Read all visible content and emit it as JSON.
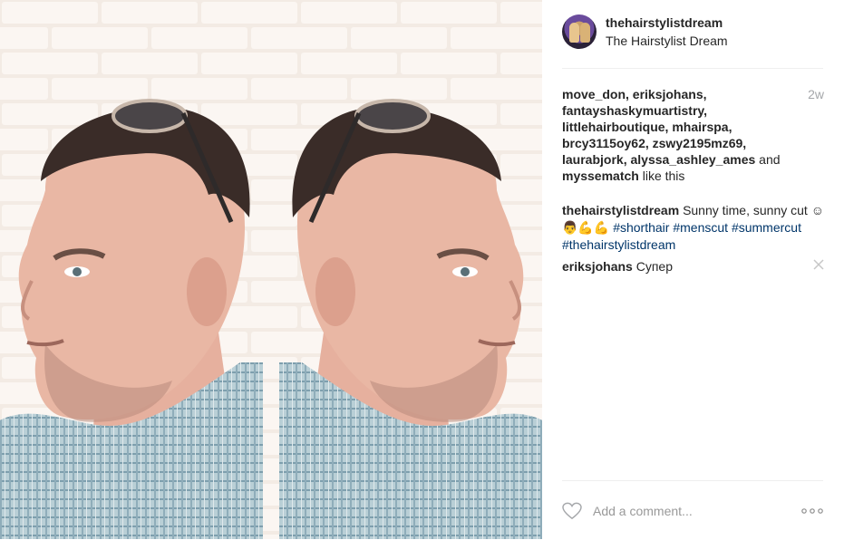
{
  "post": {
    "image_alt": "",
    "author": {
      "username": "thehairstylistdream",
      "full_name": "The Hairstylist Dream"
    },
    "time_ago": "2w",
    "likes": {
      "users": [
        "move_don,",
        "eriksjohans,",
        "fantayshaskymuartistry,",
        "littlehairboutique,",
        "mhairspa,",
        "brcy3115oy62,",
        "zswy2195mz69,",
        "laurabjork,",
        "alyssa_ashley_ames",
        "myssematch"
      ],
      "and_text": "and",
      "suffix": "like this"
    },
    "caption": {
      "username": "thehairstylistdream",
      "text": "Sunny time, sunny cut",
      "emoji": "☺👨💪💪",
      "hashtags": [
        "#shorthair",
        "#menscut",
        "#summercut",
        "#thehairstylistdream"
      ]
    },
    "comments": [
      {
        "username": "eriksjohans",
        "text": "Супер"
      }
    ],
    "comment_box": {
      "placeholder": "Add a comment..."
    }
  },
  "icons": {
    "heart": "heart-icon",
    "more": "more-options-icon",
    "close": "close-icon"
  },
  "colors": {
    "hashtag": "#003569",
    "muted": "#999999",
    "text": "#262626"
  }
}
